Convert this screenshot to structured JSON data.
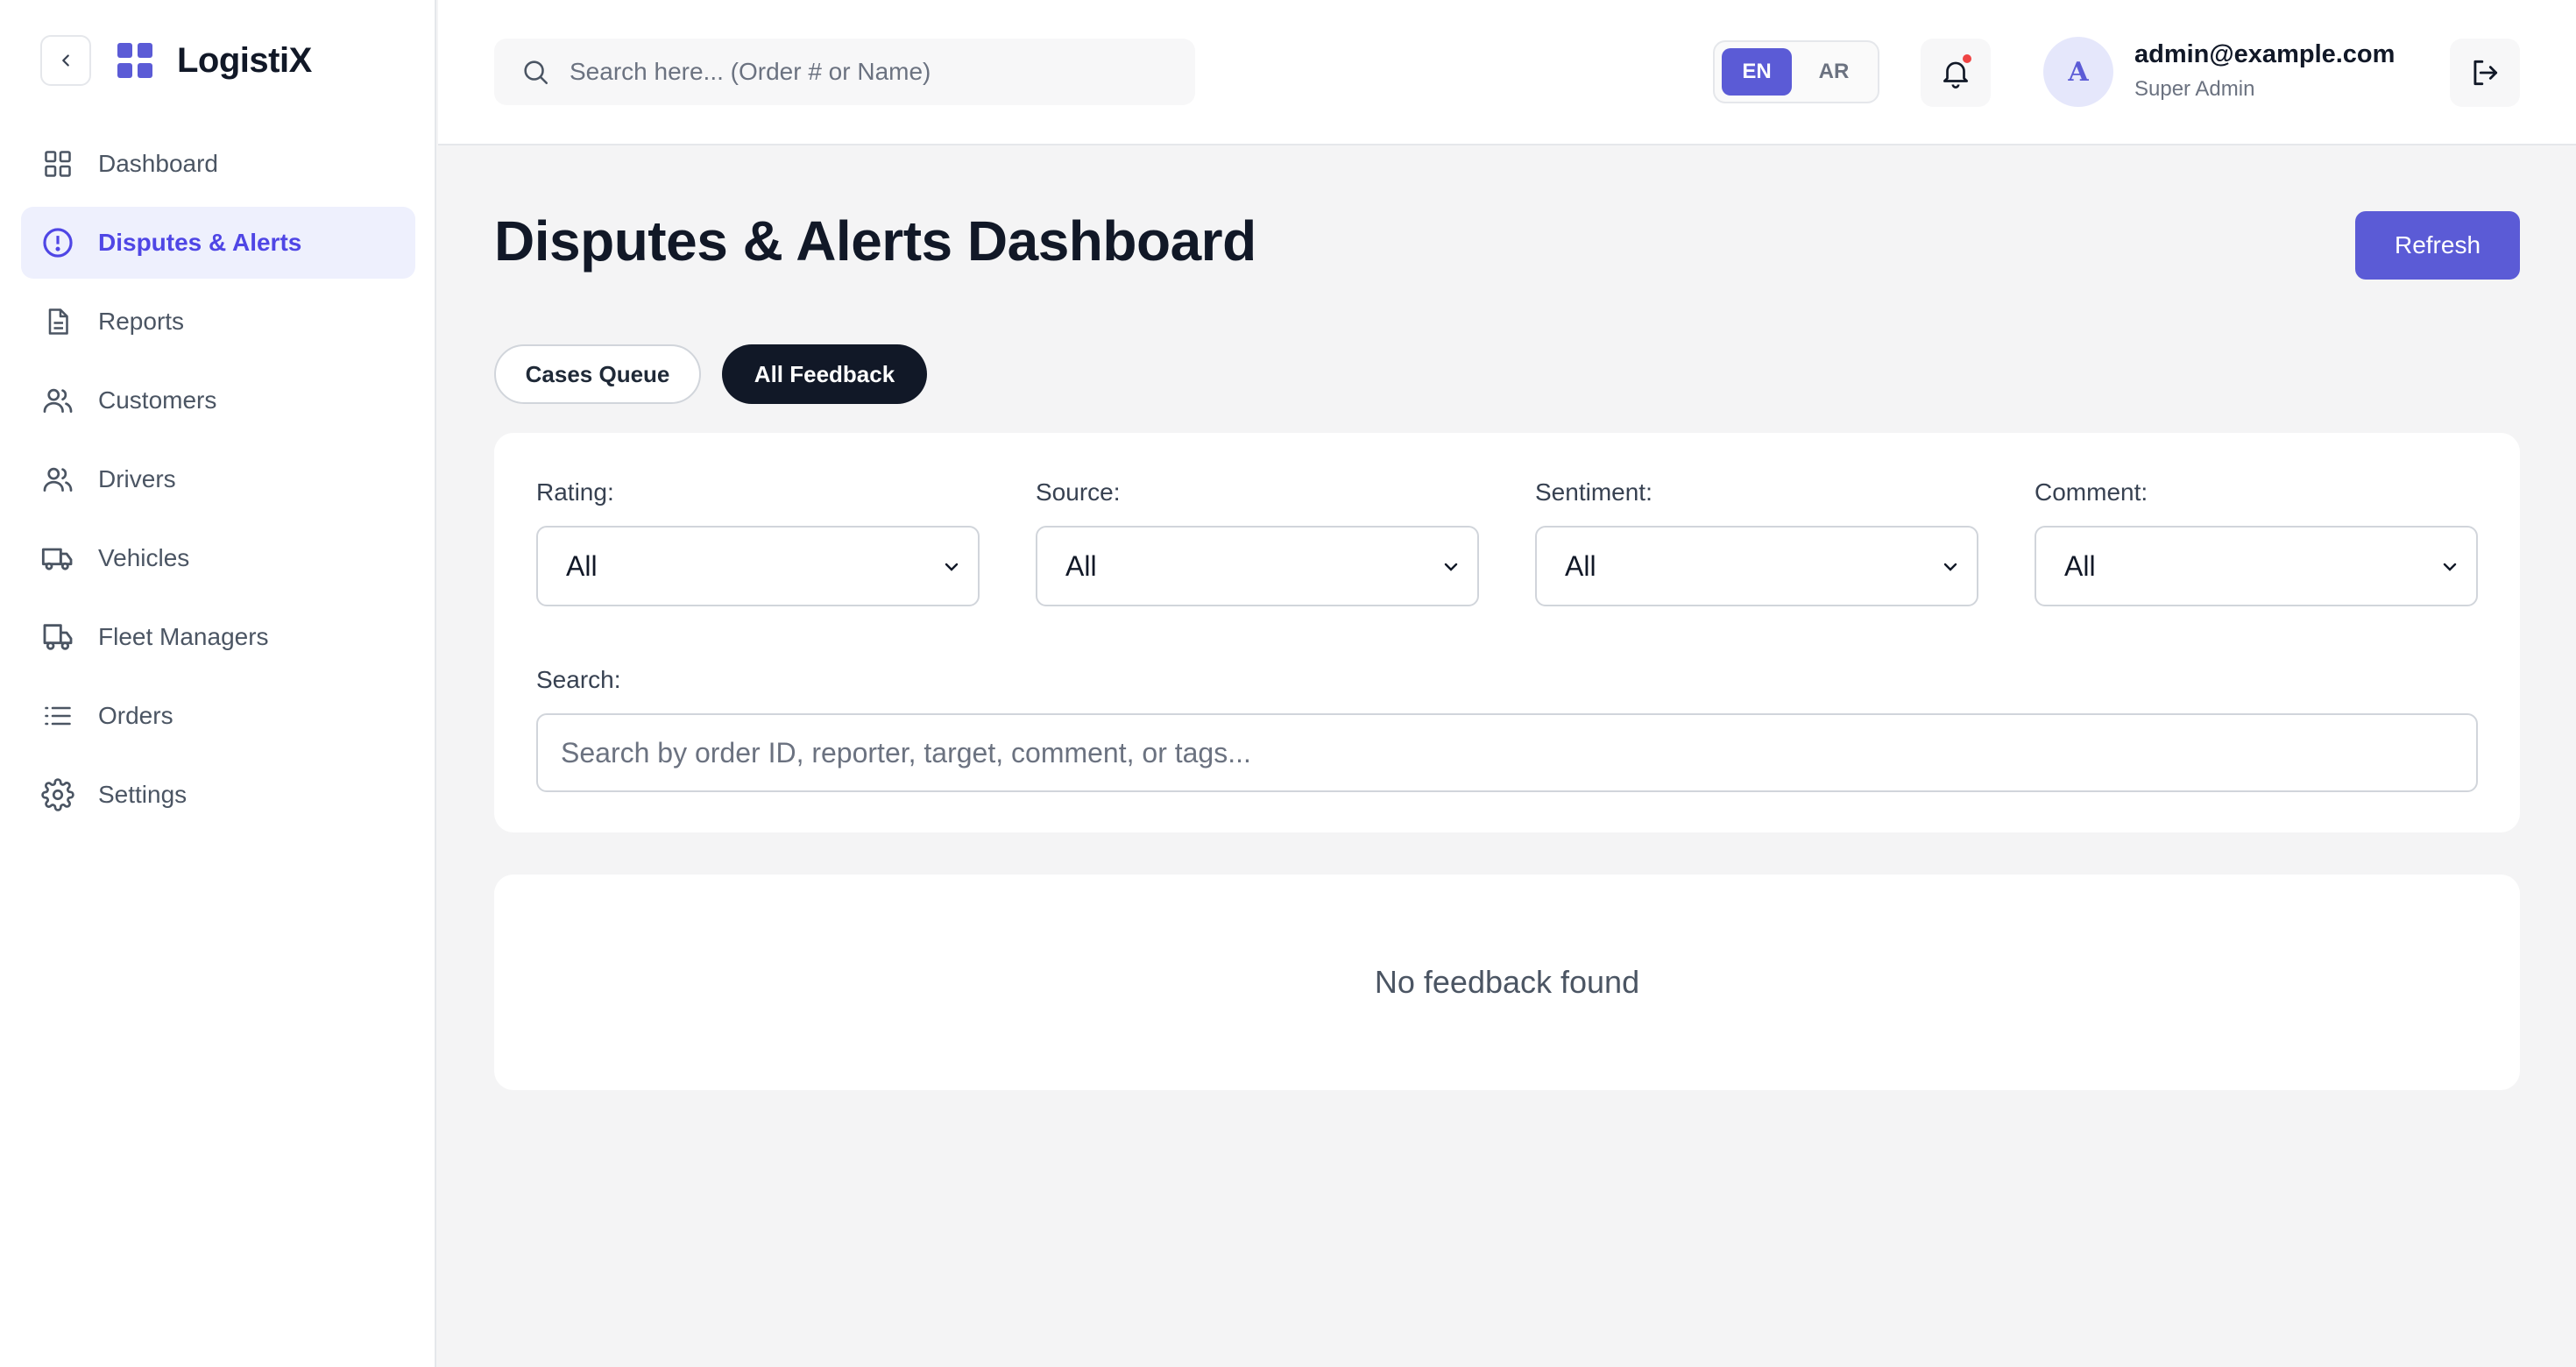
{
  "brand": {
    "name": "LogistiX",
    "accent": "#5b5bd6"
  },
  "sidebar": {
    "items": [
      {
        "label": "Dashboard",
        "icon": "dashboard-grid-icon",
        "active": false
      },
      {
        "label": "Disputes & Alerts",
        "icon": "alert-circle-icon",
        "active": true
      },
      {
        "label": "Reports",
        "icon": "document-icon",
        "active": false
      },
      {
        "label": "Customers",
        "icon": "users-icon",
        "active": false
      },
      {
        "label": "Drivers",
        "icon": "users-icon",
        "active": false
      },
      {
        "label": "Vehicles",
        "icon": "truck-icon",
        "active": false
      },
      {
        "label": "Fleet Managers",
        "icon": "truck-box-icon",
        "active": false
      },
      {
        "label": "Orders",
        "icon": "list-icon",
        "active": false
      },
      {
        "label": "Settings",
        "icon": "gear-icon",
        "active": false
      }
    ]
  },
  "header": {
    "search_placeholder": "Search here... (Order # or Name)",
    "languages": [
      "EN",
      "AR"
    ],
    "active_language": "EN",
    "user": {
      "initial": "A",
      "email": "admin@example.com",
      "role": "Super Admin"
    }
  },
  "main": {
    "title": "Disputes & Alerts Dashboard",
    "refresh_label": "Refresh",
    "tabs": [
      {
        "label": "Cases Queue",
        "active": false
      },
      {
        "label": "All Feedback",
        "active": true
      }
    ],
    "filters": [
      {
        "label": "Rating:",
        "value": "All"
      },
      {
        "label": "Source:",
        "value": "All"
      },
      {
        "label": "Sentiment:",
        "value": "All"
      },
      {
        "label": "Comment:",
        "value": "All"
      }
    ],
    "search": {
      "label": "Search:",
      "placeholder": "Search by order ID, reporter, target, comment, or tags...",
      "value": ""
    },
    "empty_message": "No feedback found"
  }
}
